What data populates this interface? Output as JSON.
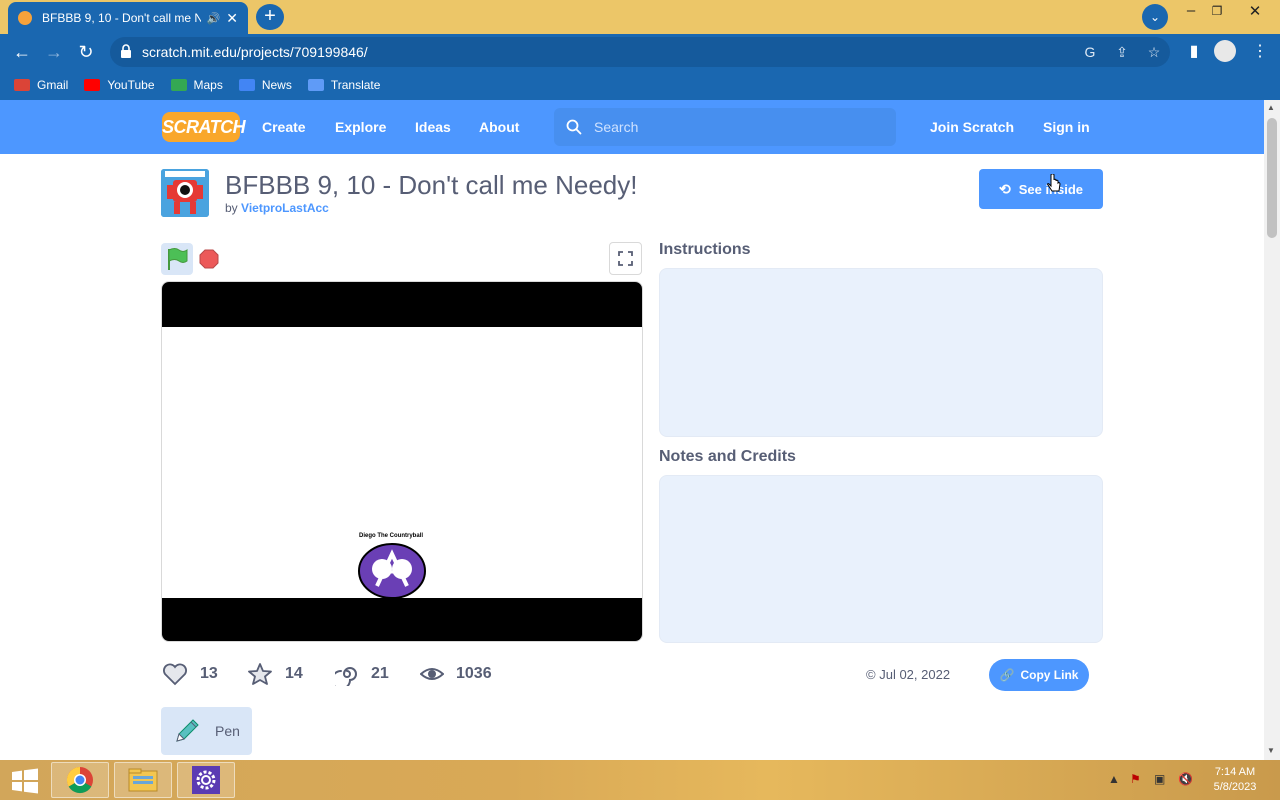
{
  "browser": {
    "tab_title": "BFBBB 9, 10 - Don't call me N",
    "url": "scratch.mit.edu/projects/709199846/",
    "bookmarks": [
      {
        "label": "Gmail",
        "color": "#db4437"
      },
      {
        "label": "YouTube",
        "color": "#ff0000"
      },
      {
        "label": "Maps",
        "color": "#34a853"
      },
      {
        "label": "News",
        "color": "#4285f4"
      },
      {
        "label": "Translate",
        "color": "#5f9bf7"
      }
    ]
  },
  "scratch_nav": {
    "logo": "SCRATCH",
    "links": [
      "Create",
      "Explore",
      "Ideas",
      "About"
    ],
    "search_placeholder": "Search",
    "join": "Join Scratch",
    "signin": "Sign in"
  },
  "project": {
    "title": "BFBBB 9, 10 - Don't call me Needy!",
    "by_prefix": "by",
    "author": "VietproLastAcc",
    "see_inside": "See inside",
    "sprite_label": "Diego The Countryball",
    "instructions_heading": "Instructions",
    "notes_heading": "Notes and Credits",
    "stats": {
      "loves": "13",
      "favorites": "14",
      "remixes": "21",
      "views": "1036"
    },
    "date": "Jul 02, 2022",
    "copy_link": "Copy Link",
    "tag": "Pen"
  },
  "taskbar": {
    "time": "7:14 AM",
    "date": "5/8/2023"
  },
  "colors": {
    "scratch_blue": "#4d97ff",
    "chrome_blue": "#1a67b0",
    "tabstrip": "#ecc668",
    "text": "#575e75"
  }
}
